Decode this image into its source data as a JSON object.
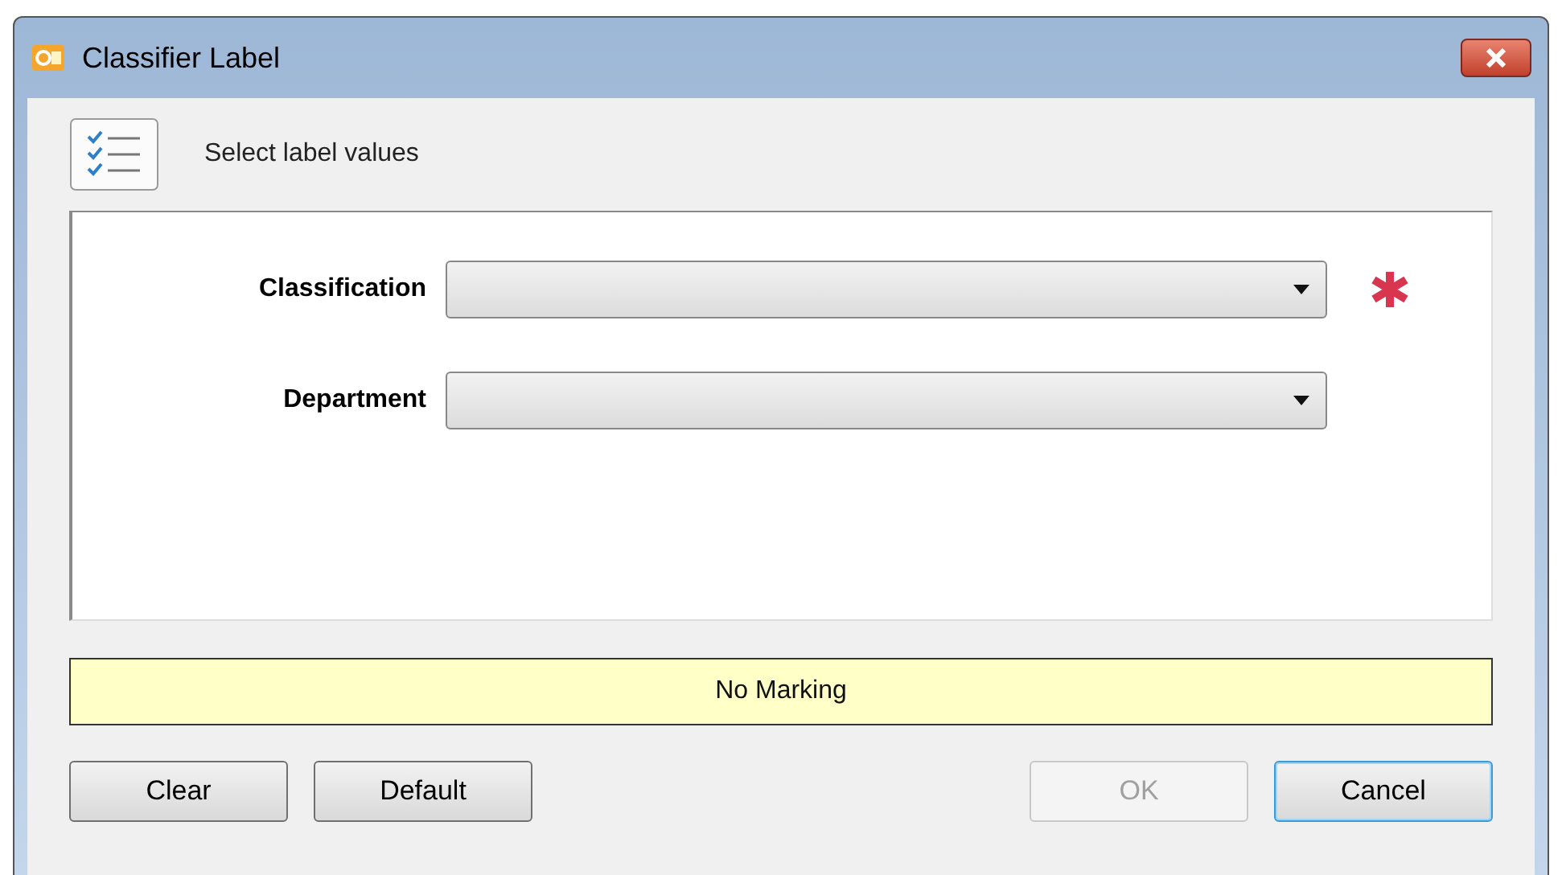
{
  "window": {
    "title": "Classifier Label"
  },
  "header": {
    "text": "Select label values"
  },
  "fields": [
    {
      "label": "Classification",
      "required": true
    },
    {
      "label": "Department",
      "required": false
    }
  ],
  "marking": {
    "text": "No Marking"
  },
  "left_buttons": [
    {
      "label": "Clear",
      "disabled": false,
      "focused": false
    },
    {
      "label": "Default",
      "disabled": false,
      "focused": false
    }
  ],
  "right_buttons": [
    {
      "label": "OK",
      "disabled": true,
      "focused": false
    },
    {
      "label": "Cancel",
      "disabled": false,
      "focused": true
    }
  ]
}
